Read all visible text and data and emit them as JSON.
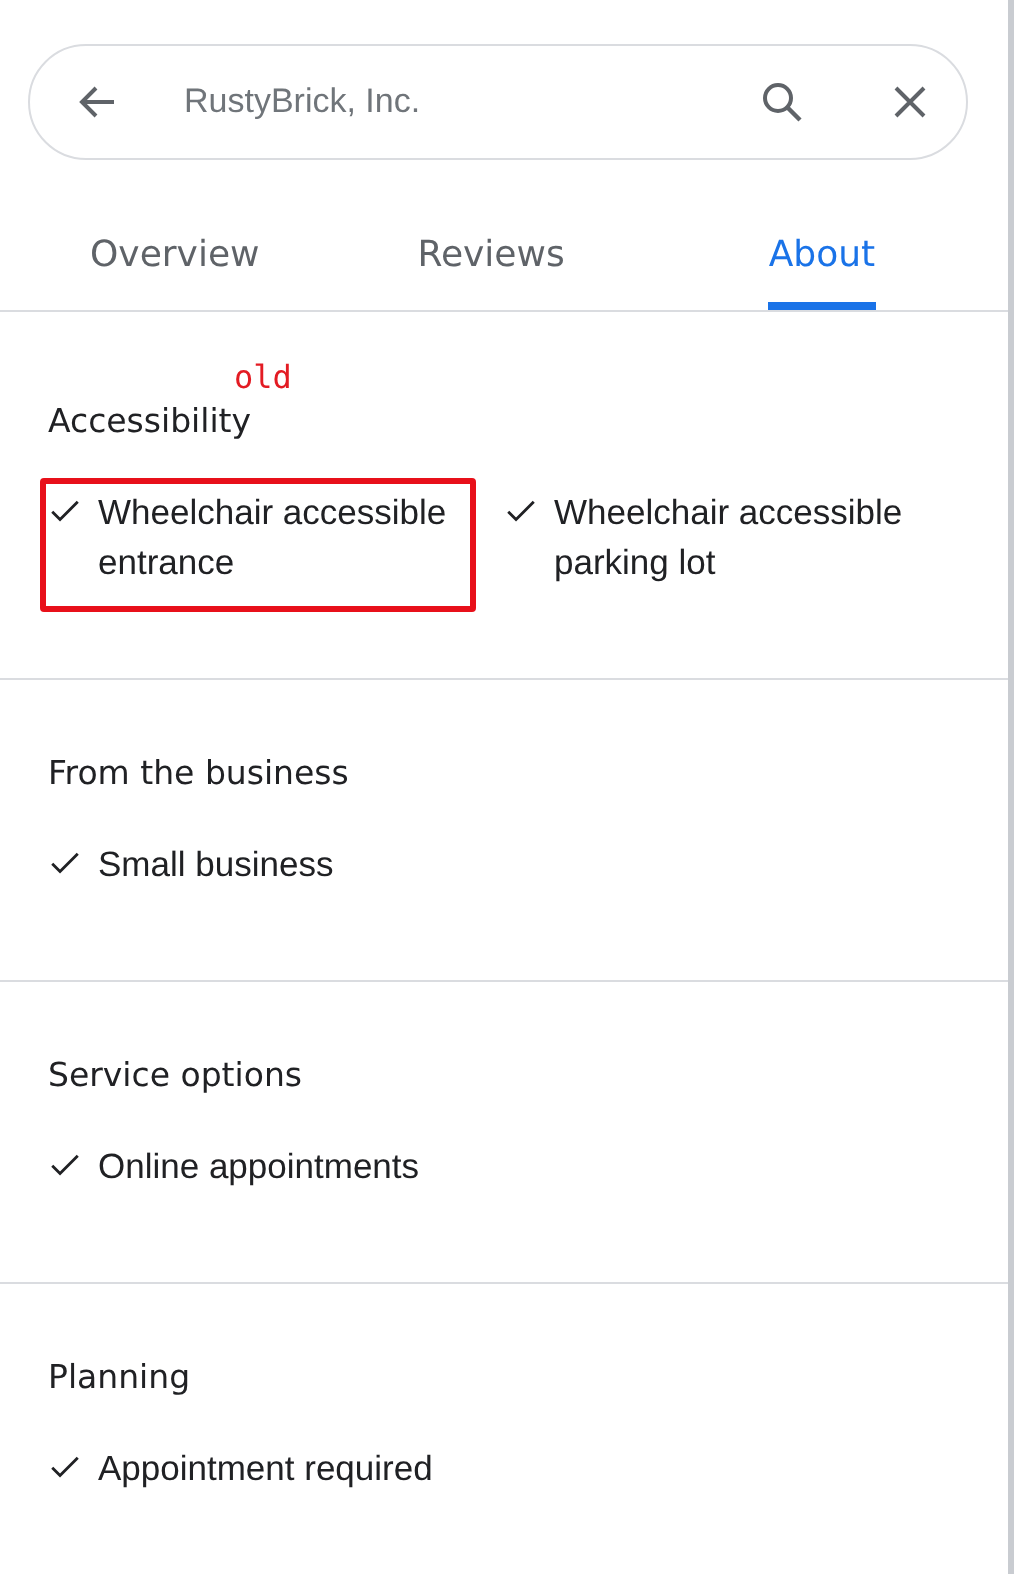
{
  "search": {
    "value": "RustyBrick, Inc."
  },
  "tabs": [
    {
      "label": "Overview",
      "selected": false
    },
    {
      "label": "Reviews",
      "selected": false
    },
    {
      "label": "About",
      "selected": true
    }
  ],
  "sections": [
    {
      "title": "Accessibility",
      "note": "old",
      "items": [
        {
          "label": "Wheelchair accessible entrance",
          "checked": true,
          "highlighted": true
        },
        {
          "label": "Wheelchair accessible parking lot",
          "checked": true,
          "highlighted": false
        }
      ]
    },
    {
      "title": "From the business",
      "items": [
        {
          "label": "Small business",
          "checked": true,
          "highlighted": false
        }
      ]
    },
    {
      "title": "Service options",
      "items": [
        {
          "label": "Online appointments",
          "checked": true,
          "highlighted": false
        }
      ]
    },
    {
      "title": "Planning",
      "items": [
        {
          "label": "Appointment required",
          "checked": true,
          "highlighted": false
        }
      ]
    }
  ]
}
